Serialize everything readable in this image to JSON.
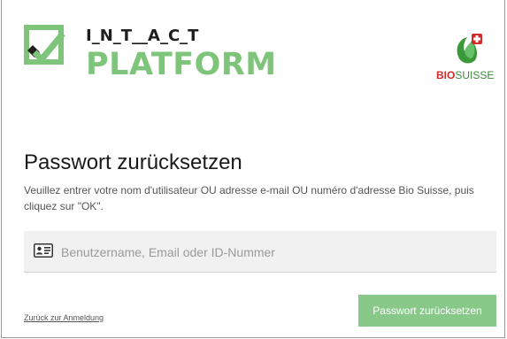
{
  "logo": {
    "top_text": "I_N_T__A_C_T",
    "bottom_text": "PLATFORM",
    "icon": "check-box-icon",
    "color": "#7ec57b"
  },
  "partner_logo": {
    "bold": "BIO",
    "rest": "SUISSE",
    "icon": "bud-icon"
  },
  "title": "Passwort zurücksetzen",
  "description": "Veuillez entrer votre nom d'utilisateur OU adresse e-mail OU numéro d'adresse Bio Suisse, puis cliquez sur \"OK\".",
  "field": {
    "placeholder": "Benutzername, Email oder ID-Nummer",
    "value": "",
    "icon": "id-card-icon"
  },
  "back_link": "Zurück zur Anmeldung",
  "submit_button": "Passwort zurücksetzen",
  "colors": {
    "accent": "#7ec57b",
    "button": "#88c98a"
  }
}
